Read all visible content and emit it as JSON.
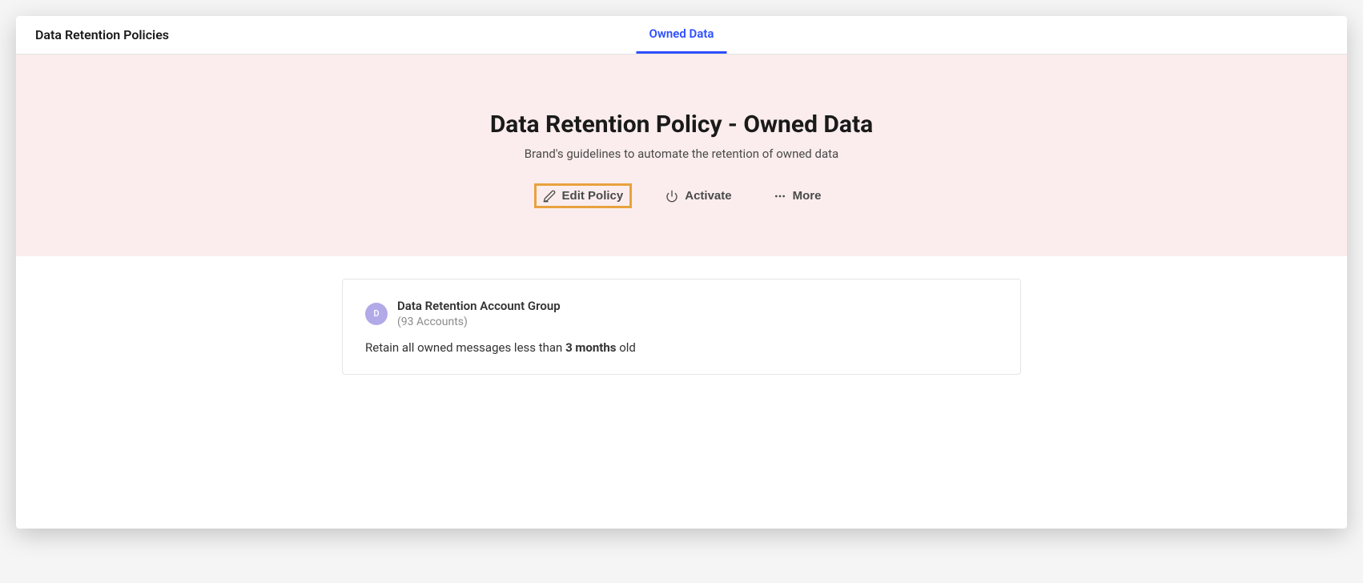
{
  "header": {
    "title": "Data Retention Policies"
  },
  "tabs": {
    "active": "Owned Data"
  },
  "hero": {
    "title": "Data Retention Policy - Owned Data",
    "subtitle": "Brand's guidelines to automate the retention of owned data"
  },
  "actions": {
    "edit": "Edit Policy",
    "activate": "Activate",
    "more": "More"
  },
  "card": {
    "avatar_letter": "D",
    "group_name": "Data Retention Account Group",
    "account_count": "(93 Accounts)",
    "desc_pre": "Retain all owned messages less than ",
    "desc_bold": "3 months",
    "desc_post": " old"
  }
}
